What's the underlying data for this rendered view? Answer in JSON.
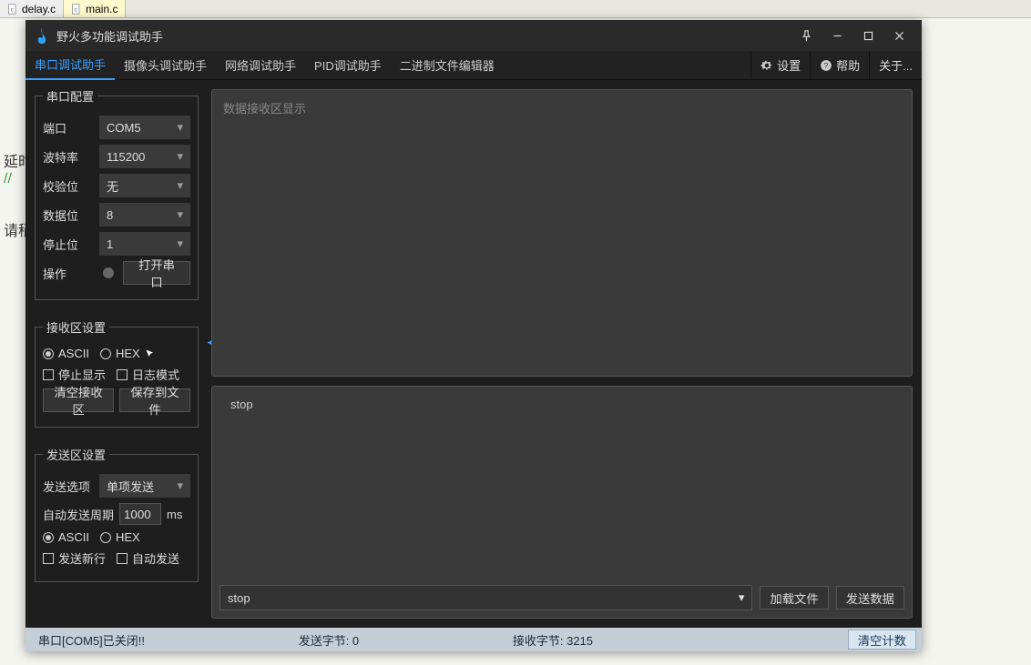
{
  "bg": {
    "tabs": [
      "delay.c",
      "main.c"
    ],
    "lines": [
      "延时",
      "// ",
      " ",
      "请稍"
    ]
  },
  "title": "野火多功能调试助手",
  "mainTabs": [
    "串口调试助手",
    "摄像头调试助手",
    "网络调试助手",
    "PID调试助手",
    "二进制文件编辑器"
  ],
  "menuRight": {
    "settings": "设置",
    "help": "帮助",
    "about": "关于..."
  },
  "serial": {
    "legend": "串口配置",
    "port_label": "端口",
    "port": "COM5",
    "baud_label": "波特率",
    "baud": "115200",
    "parity_label": "校验位",
    "parity": "无",
    "data_label": "数据位",
    "data": "8",
    "stop_label": "停止位",
    "stop": "1",
    "op_label": "操作",
    "open_btn": "打开串口"
  },
  "recvCfg": {
    "legend": "接收区设置",
    "ascii": "ASCII",
    "hex": "HEX",
    "stop_disp": "停止显示",
    "log_mode": "日志模式",
    "clear": "清空接收区",
    "save": "保存到文件"
  },
  "sendCfg": {
    "legend": "发送区设置",
    "opt_label": "发送选项",
    "opt": "单项发送",
    "period_label": "自动发送周期",
    "period": "1000",
    "ms": "ms",
    "ascii": "ASCII",
    "hex": "HEX",
    "newline": "发送新行",
    "autosend": "自动发送"
  },
  "recvArea": {
    "placeholder": "数据接收区显示"
  },
  "sendArea": {
    "history": "stop",
    "input": "stop",
    "load": "加载文件",
    "send": "发送数据"
  },
  "status": {
    "left": "串口[COM5]已关闭!!",
    "sent": "发送字节: 0",
    "recv": "接收字节: 3215",
    "clear": "清空计数"
  }
}
